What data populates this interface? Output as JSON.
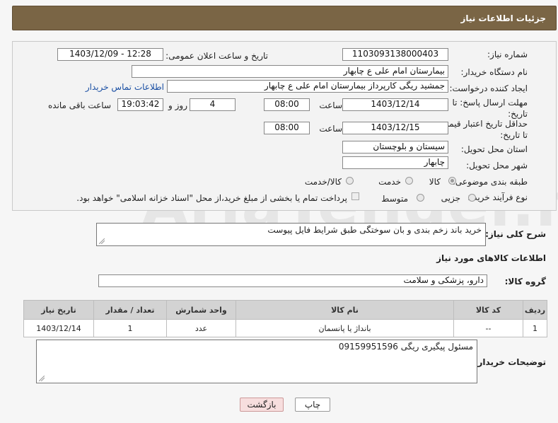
{
  "header": {
    "title": "جزئیات اطلاعات نیاز"
  },
  "form": {
    "need_number_label": "شماره نیاز:",
    "need_number": "1103093138000403",
    "announce_label": "تاریخ و ساعت اعلان عمومی:",
    "announce_value": "1403/12/09 - 12:28",
    "buyer_org_label": "نام دستگاه خریدار:",
    "buyer_org": "بیمارستان امام علی  ع  چابهار",
    "creator_label": "ایجاد کننده درخواست:",
    "creator": "جمشید ریگی کارپرداز بیمارستان امام علی  ع  چابهار",
    "contact_link": "اطلاعات تماس خریدار",
    "deadline_label": "مهلت ارسال پاسخ: تا تاریخ:",
    "deadline_date": "1403/12/14",
    "time_label": "ساعت",
    "deadline_time": "08:00",
    "days_value": "4",
    "days_label": "روز و",
    "remaining_time": "19:03:42",
    "remaining_label": "ساعت باقی مانده",
    "validity_label": "حداقل تاریخ اعتبار قیمت: تا تاریخ:",
    "validity_date": "1403/12/15",
    "validity_time": "08:00",
    "province_label": "استان محل تحویل:",
    "province": "سیستان و بلوچستان",
    "city_label": "شهر محل تحویل:",
    "city": "چابهار",
    "category_label": "طبقه بندی موضوعی:",
    "category_options": [
      "کالا",
      "خدمت",
      "کالا/خدمت"
    ],
    "category_selected": "کالا",
    "process_label": "نوع فرآیند خرید :",
    "process_options": [
      "جزیی",
      "متوسط"
    ],
    "payment_note": "پرداخت تمام یا بخشی از مبلغ خرید،از محل \"اسناد خزانه اسلامی\" خواهد بود."
  },
  "description": {
    "label": "شرح کلی نیاز:",
    "text": "خرید باند زخم بندی و بان سوختگی طبق شرایط فایل پیوست"
  },
  "goods": {
    "section_title": "اطلاعات کالاهای مورد نیاز",
    "group_label": "گروه کالا:",
    "group_value": "دارو، پزشکی و سلامت",
    "columns": [
      "ردیف",
      "کد کالا",
      "نام کالا",
      "واحد شمارش",
      "تعداد / مقدار",
      "تاریخ نیاز"
    ],
    "rows": [
      {
        "row": "1",
        "code": "--",
        "name": "بانداژ یا پانسمان",
        "unit": "عدد",
        "qty": "1",
        "date": "1403/12/14"
      }
    ]
  },
  "buyer_notes": {
    "label": "توضیحات خریدار:",
    "text": "مسئول پیگیری ریگی 09159951596"
  },
  "buttons": {
    "print": "چاپ",
    "back": "بازگشت"
  },
  "watermark": "AriaTender.net",
  "colors": {
    "header_bg": "#7a6545",
    "link": "#1a4fa3",
    "back_button_bg": "#f7dede"
  }
}
